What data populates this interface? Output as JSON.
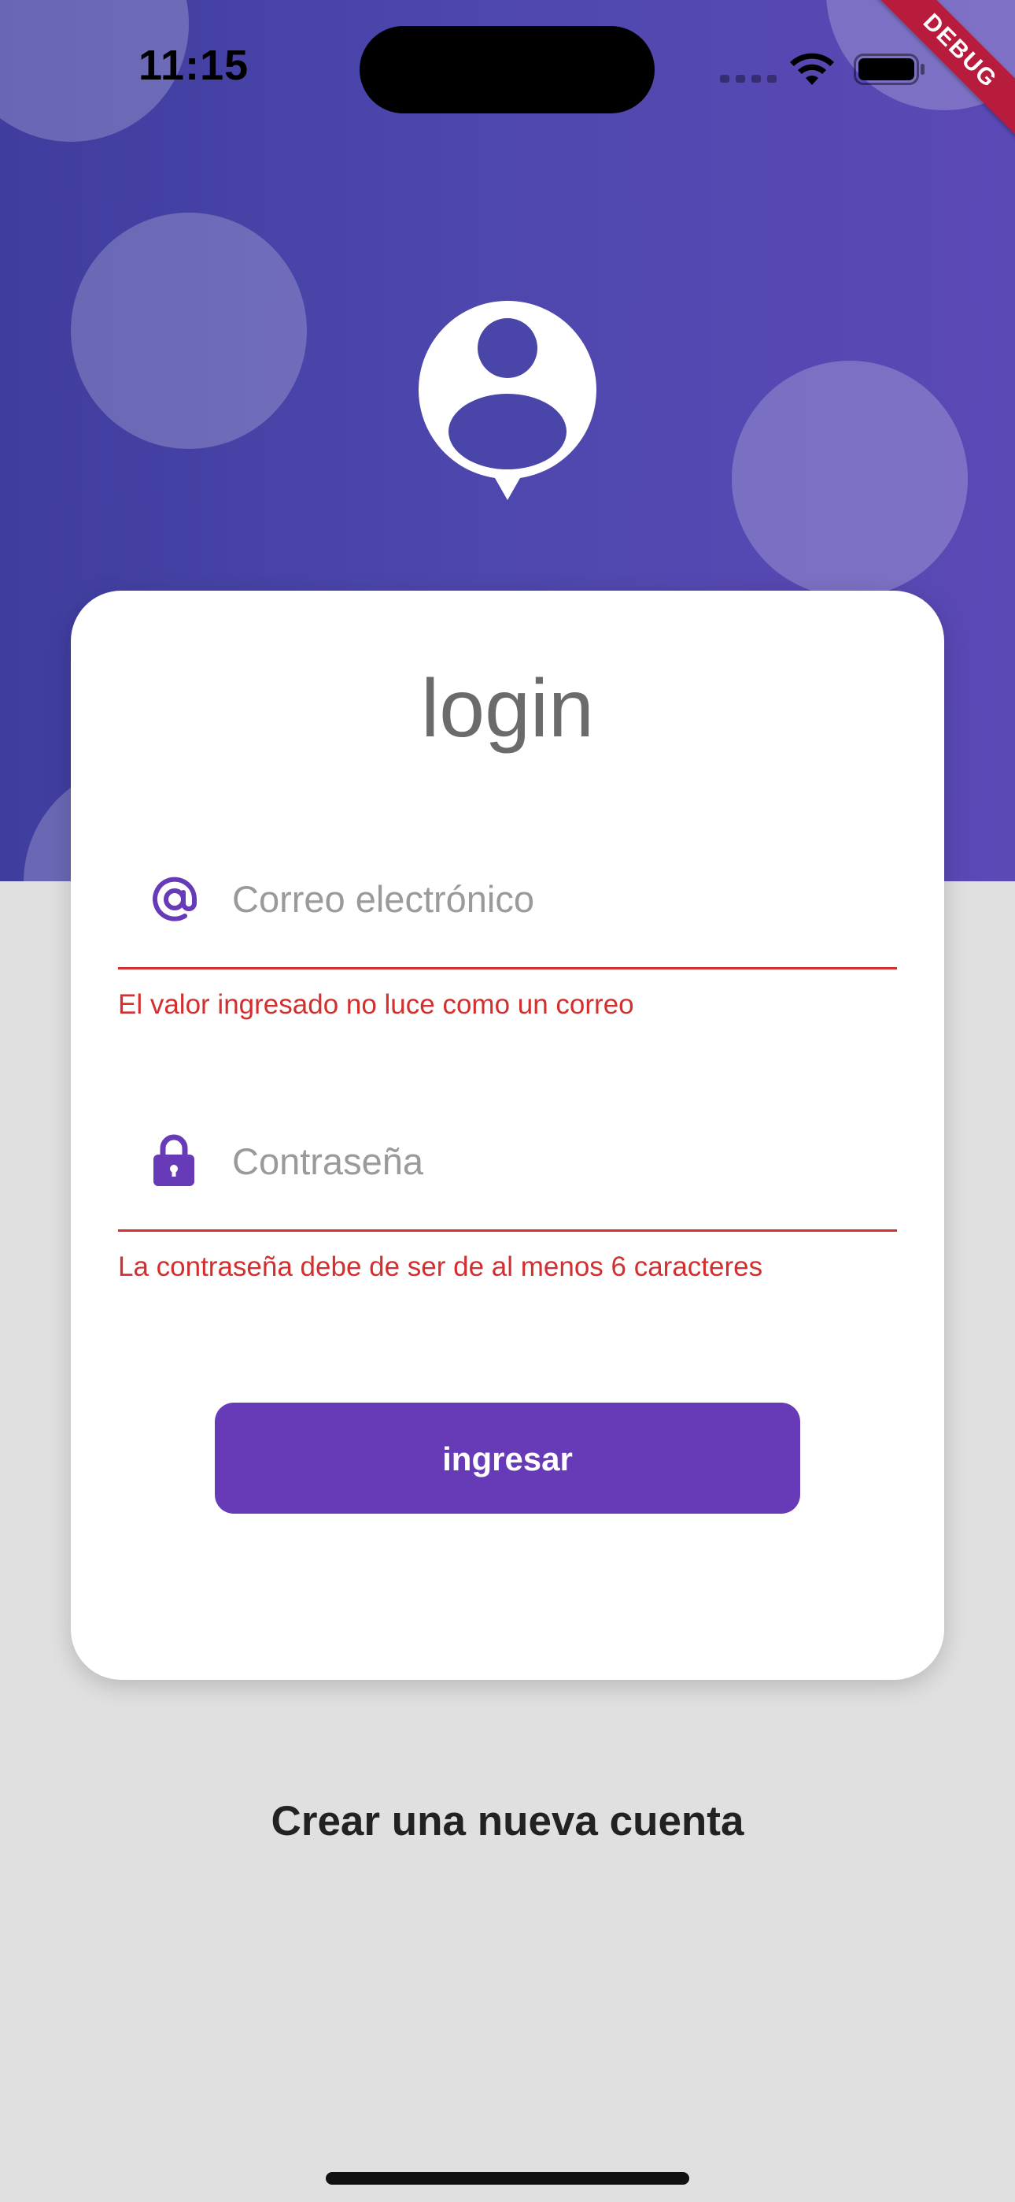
{
  "status_bar": {
    "time": "11:15",
    "debug_label": "DEBUG"
  },
  "login": {
    "title": "login",
    "email": {
      "placeholder": "Correo electrónico",
      "icon": "at-icon",
      "error": "El valor ingresado no luce como un correo"
    },
    "password": {
      "placeholder": "Contraseña",
      "icon": "lock-icon",
      "error": "La contraseña debe de ser de al menos 6 caracteres"
    },
    "submit_label": "ingresar"
  },
  "footer": {
    "create_account_label": "Crear una nueva cuenta"
  },
  "colors": {
    "primary": "#673ab7",
    "error": "#d32f2f",
    "hero_start": "#3f3d9e",
    "hero_end": "#5b49b6",
    "background": "#e0e0e0"
  }
}
